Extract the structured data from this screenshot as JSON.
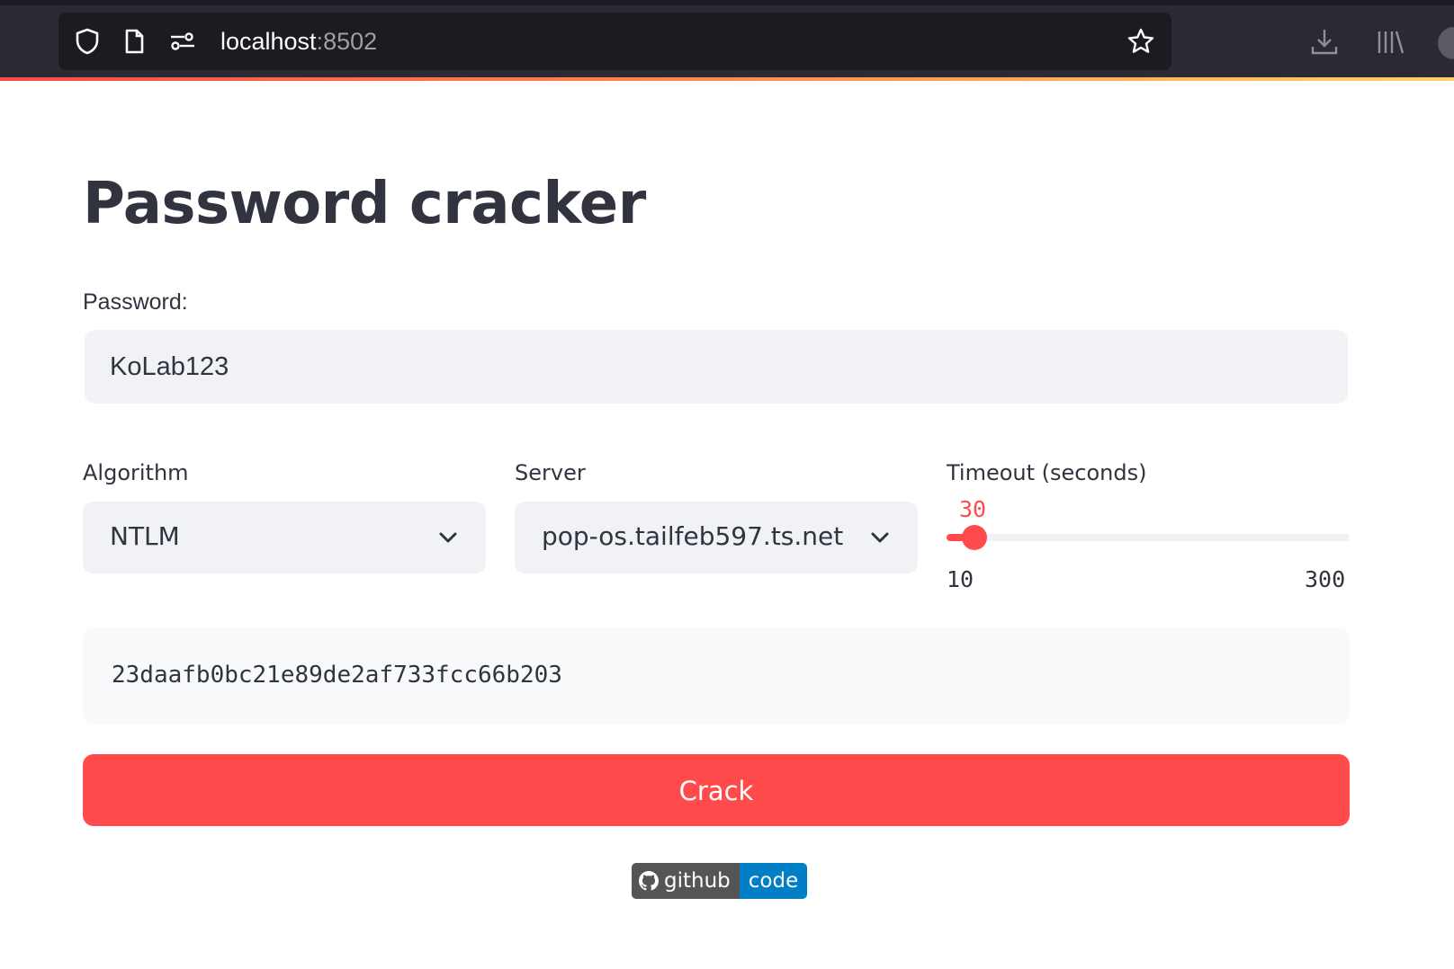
{
  "browser": {
    "url_host": "localhost",
    "url_port": ":8502",
    "icons": [
      "shield-icon",
      "page-icon",
      "permissions-icon",
      "bookmark-star-icon",
      "downloads-icon",
      "library-icon",
      "account-icon"
    ]
  },
  "page": {
    "title": "Password cracker"
  },
  "password": {
    "label": "Password:",
    "value": "KoLab123"
  },
  "algorithm": {
    "label": "Algorithm",
    "selected": "NTLM"
  },
  "server": {
    "label": "Server",
    "selected": "pop-os.tailfeb597.ts.net"
  },
  "timeout": {
    "label": "Timeout (seconds)",
    "value": 30,
    "value_text": "30",
    "min": 10,
    "max": 300,
    "min_text": "10",
    "max_text": "300"
  },
  "hash": {
    "value": "23daafb0bc21e89de2af733fcc66b203"
  },
  "actions": {
    "crack_label": "Crack"
  },
  "badge": {
    "left_text": "github",
    "right_text": "code"
  },
  "colors": {
    "accent": "#ff4b4b",
    "text": "#31333f",
    "input_bg": "#f0f2f6",
    "badge_left": "#555555",
    "badge_right": "#007ec6"
  }
}
